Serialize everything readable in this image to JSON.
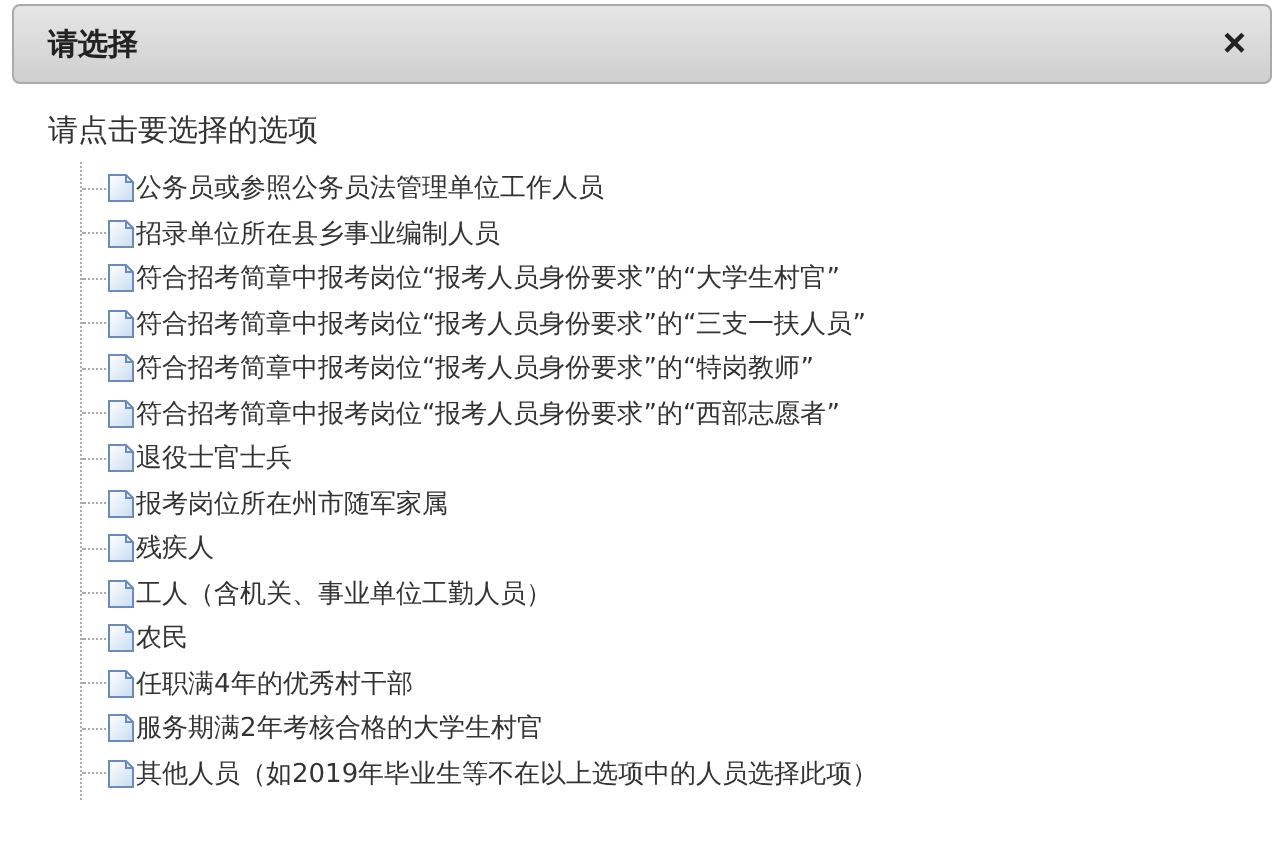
{
  "dialog": {
    "title": "请选择",
    "close": "×"
  },
  "prompt": "请点击要选择的选项",
  "options": [
    {
      "label": "公务员或参照公务员法管理单位工作人员"
    },
    {
      "label": "招录单位所在县乡事业编制人员"
    },
    {
      "label": "符合招考简章中报考岗位“报考人员身份要求”的“大学生村官”"
    },
    {
      "label": "符合招考简章中报考岗位“报考人员身份要求”的“三支一扶人员”"
    },
    {
      "label": "符合招考简章中报考岗位“报考人员身份要求”的“特岗教师”"
    },
    {
      "label": "符合招考简章中报考岗位“报考人员身份要求”的“西部志愿者”"
    },
    {
      "label": "退役士官士兵"
    },
    {
      "label": "报考岗位所在州市随军家属"
    },
    {
      "label": "残疾人"
    },
    {
      "label": "工人（含机关、事业单位工勤人员）"
    },
    {
      "label": "农民"
    },
    {
      "label": "任职满4年的优秀村干部"
    },
    {
      "label": "服务期满2年考核合格的大学生村官"
    },
    {
      "label": "其他人员（如2019年毕业生等不在以上选项中的人员选择此项）"
    }
  ]
}
